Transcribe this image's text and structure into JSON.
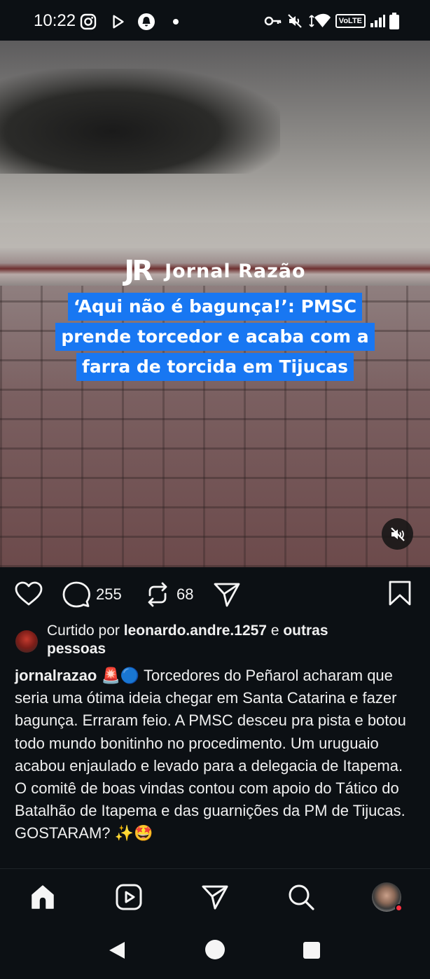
{
  "status_bar": {
    "time": "10:22",
    "left_icons": [
      "instagram-icon",
      "play-store-icon",
      "notification-app-icon",
      "dot-icon"
    ],
    "right_icons": [
      "key-icon",
      "muted-icon",
      "wifi-icon",
      "volte-badge",
      "signal-icon",
      "battery-icon"
    ],
    "volte_label": "VoLTE"
  },
  "media": {
    "brand_logo": "JR",
    "brand_name": "Jornal Razão",
    "headline_lines": [
      "‘Aqui não é bagunça!’: PMSC",
      "prende torcedor e acaba com a",
      "farra de torcida em Tijucas"
    ],
    "headline_bg_color": "#1877f2",
    "mute_icon": "speaker-muted-icon"
  },
  "actions": {
    "like_icon": "heart-icon",
    "comment_icon": "comment-icon",
    "comment_count": "255",
    "repost_icon": "repost-icon",
    "repost_count": "68",
    "share_icon": "send-icon",
    "save_icon": "bookmark-icon"
  },
  "liked_by": {
    "prefix": "Curtido por",
    "user": "leonardo.andre.1257",
    "connector": "e",
    "others": "outras",
    "others_line2": "pessoas"
  },
  "caption": {
    "username": "jornalrazao",
    "emoji": "🚨🔵",
    "text": "Torcedores do Peñarol acharam que seria uma ótima ideia chegar em Santa Catarina e fazer bagunça. Erraram feio. A PMSC desceu pra pista e botou todo mundo bonitinho no procedimento. Um uruguaio acabou enjaulado e levado para a delegacia de Itapema. O comitê de boas vindas contou com apoio do Tático do Batalhão de Itapema e das guarnições da PM de Tijucas. GOSTARAM? ✨🤩"
  },
  "bottom_nav": {
    "items": [
      "home-icon",
      "reels-icon",
      "direct-icon",
      "search-icon",
      "profile-avatar"
    ],
    "notification_dot_color": "#ff3040"
  },
  "system_nav": [
    "back-icon",
    "home-circle-icon",
    "recents-icon"
  ]
}
